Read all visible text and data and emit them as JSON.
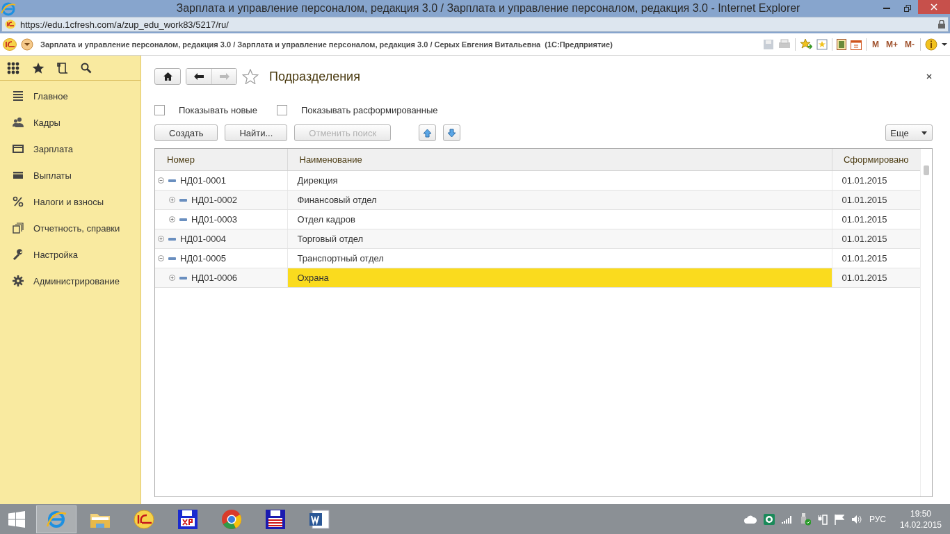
{
  "browser": {
    "title": "Зарплата и управление персоналом, редакция 3.0 / Зарплата и управление персоналом, редакция 3.0 - Internet Explorer",
    "address": "https://edu.1cfresh.com/a/zup_edu_work83/5217/ru/"
  },
  "app_bar": {
    "title": "Зарплата и управление персоналом, редакция 3.0 / Зарплата и управление персоналом, редакция 3.0 / Серых Евгения Витальевна  (1С:Предприятие)",
    "memory_buttons": [
      "M",
      "M+",
      "M-"
    ]
  },
  "sidebar": {
    "items": [
      {
        "label": "Главное",
        "kind": "list"
      },
      {
        "label": "Кадры",
        "kind": "people"
      },
      {
        "label": "Зарплата",
        "kind": "card"
      },
      {
        "label": "Выплаты",
        "kind": "wallet"
      },
      {
        "label": "Налоги и взносы",
        "kind": "percent"
      },
      {
        "label": "Отчетность, справки",
        "kind": "docs"
      },
      {
        "label": "Настройка",
        "kind": "wrench"
      },
      {
        "label": "Администрирование",
        "kind": "gear"
      }
    ]
  },
  "form": {
    "title": "Подразделения",
    "checkboxes": [
      {
        "label": "Показывать новые",
        "checked": false
      },
      {
        "label": "Показывать расформированные",
        "checked": false
      }
    ],
    "buttons": [
      {
        "label": "Создать",
        "disabled": false
      },
      {
        "label": "Найти...",
        "disabled": false
      },
      {
        "label": "Отменить поиск",
        "disabled": true
      }
    ],
    "more": "Еще",
    "table": {
      "columns": [
        "Номер",
        "Наименование",
        "Сформировано"
      ],
      "rows": [
        {
          "number": "НД01-0001",
          "name": "Дирекция",
          "date": "01.01.2015",
          "expanded": true,
          "selected": false,
          "children": [
            {
              "number": "НД01-0002",
              "name": "Финансовый отдел",
              "date": "01.01.2015",
              "expanded": false,
              "selected": false
            },
            {
              "number": "НД01-0003",
              "name": "Отдел кадров",
              "date": "01.01.2015",
              "expanded": false,
              "selected": false
            }
          ]
        },
        {
          "number": "НД01-0004",
          "name": "Торговый отдел",
          "date": "01.01.2015",
          "expanded": false,
          "selected": false
        },
        {
          "number": "НД01-0005",
          "name": "Транспортный отдел",
          "date": "01.01.2015",
          "expanded": true,
          "selected": false,
          "children": [
            {
              "number": "НД01-0006",
              "name": "Охрана",
              "date": "01.01.2015",
              "expanded": false,
              "selected": true
            }
          ]
        }
      ]
    }
  },
  "taskbar": {
    "apps": [
      {
        "kind": "ie",
        "active": true
      },
      {
        "kind": "folder",
        "active": false
      },
      {
        "kind": "onec",
        "active": false
      },
      {
        "kind": "floppy-xp",
        "active": false
      },
      {
        "kind": "chrome",
        "active": false
      },
      {
        "kind": "floppy",
        "active": false
      },
      {
        "kind": "word",
        "active": false
      }
    ]
  },
  "tray": {
    "language": "РУС",
    "time": "19:50",
    "date": "14.02.2015"
  }
}
